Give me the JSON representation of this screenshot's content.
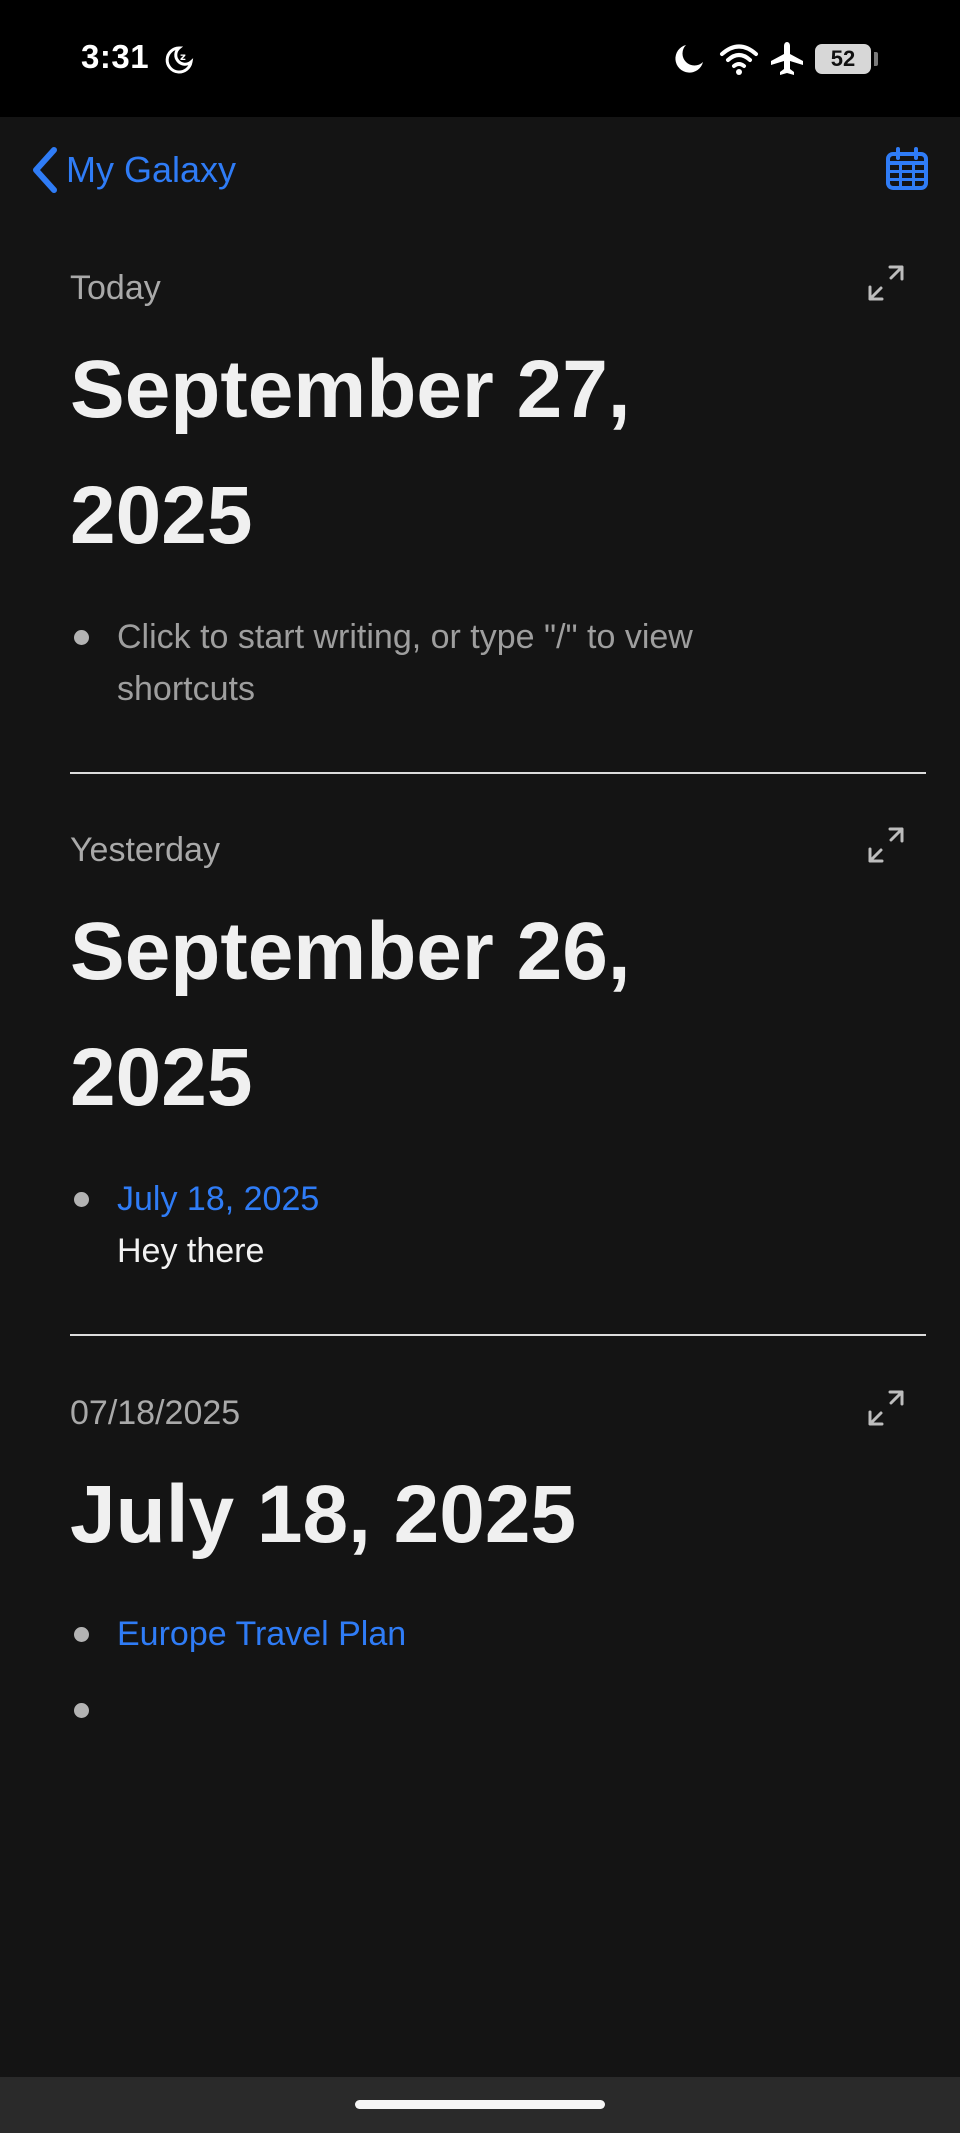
{
  "status_bar": {
    "time": "3:31",
    "battery": "52",
    "icons": [
      "sleep-icon",
      "moon-icon",
      "wifi-icon",
      "airplane-icon",
      "battery-icon"
    ]
  },
  "nav": {
    "back_label": "My Galaxy",
    "back_icon": "chevron-left-icon",
    "calendar_icon": "calendar-icon",
    "accent_color": "#2f7cf6"
  },
  "entries": [
    {
      "label": "Today",
      "title": "September 27, 2025",
      "placeholder": "Click to start writing, or type \"/\" to view shortcuts"
    },
    {
      "label": "Yesterday",
      "title": "September 26, 2025",
      "link": "July 18, 2025",
      "text": "Hey there"
    },
    {
      "label": "07/18/2025",
      "title": "July 18, 2025",
      "link": "Europe Travel Plan",
      "empty_bullet": ""
    }
  ]
}
